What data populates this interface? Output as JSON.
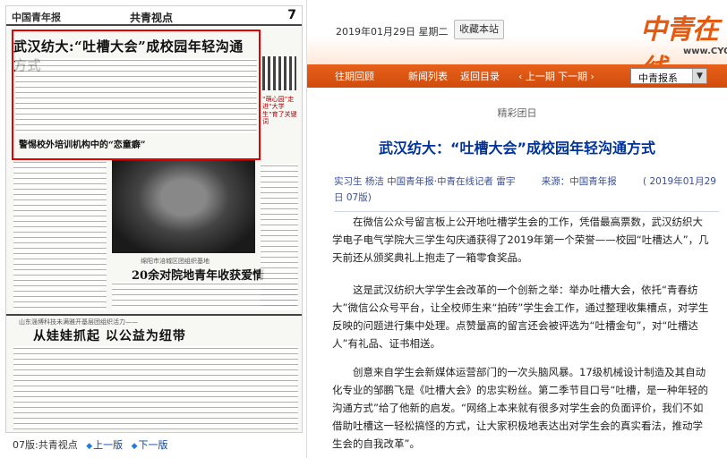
{
  "paper": {
    "logo": "中国青年报",
    "column": "共青视点",
    "page_no": "7",
    "headline_main": "武汉纺大:“吐槽大会”成校园年轻沟通方式",
    "headline_2": "警惕校外培训机构中的“恋童癖”",
    "side_note": "“萌心园”走进“大学生”育了关键词",
    "photo_caption": "绵阳市涪城区团组织基地",
    "headline_3": "20余对院地青年收获爱情",
    "section_sub": "山东淄博科技未满雅开基层团组织活力——",
    "headline_4": "从娃娃抓起 以公益为纽带"
  },
  "pager": {
    "current": "07版:共青视点",
    "prev": "上一版",
    "next": "下一版"
  },
  "header": {
    "date": "2019年01月29日 星期二",
    "bookmark": "收藏本站",
    "brand": "中青在线",
    "site": "www.CYOL.com"
  },
  "nav": {
    "items": [
      "往期回顾",
      "新闻列表",
      "返回目录",
      "上一期",
      "下一期"
    ],
    "select_value": "中青报系",
    "select_arrow": "▼"
  },
  "article": {
    "category": "精彩团日",
    "title": "武汉纺大：“吐槽大会”成校园年轻沟通方式",
    "byline": {
      "authors": "实习生 杨洁 中国青年报·中青在线记者 雷宇",
      "source": "来源：中国青年报",
      "date": "( 2019年01月29日 07版)"
    },
    "paragraphs": [
      "在微信公众号留言板上公开地吐槽学生会的工作，凭借最高票数，武汉纺织大学电子电气学院大三学生勾庆通获得了2019年第一个荣誉——校园“吐槽达人”，几天前还从颁奖典礼上抱走了一箱零食奖品。",
      "这是武汉纺织大学学生会改革的一个创新之举：举办吐槽大会，依托“青春纺大”微信公众号平台，让全校师生来“拍砖”学生会工作，通过整理收集槽点，对学生反映的问题进行集中处理。点赞量高的留言还会被评选为“吐槽金句”，对“吐槽达人”有礼品、证书相送。",
      "创意来自学生会新媒体运营部门的一次头脑风暴。17级机械设计制造及其自动化专业的邹鹏飞是《吐槽大会》的忠实粉丝。第二季节目口号“吐槽，是一种年轻的沟通方式”给了他新的启发。“网络上本来就有很多对学生会的负面评价，我们不如借助吐槽这一轻松搞怪的方式，让大家积极地表达出对学生会的真实看法，推动学生会的自我改革”。"
    ]
  }
}
